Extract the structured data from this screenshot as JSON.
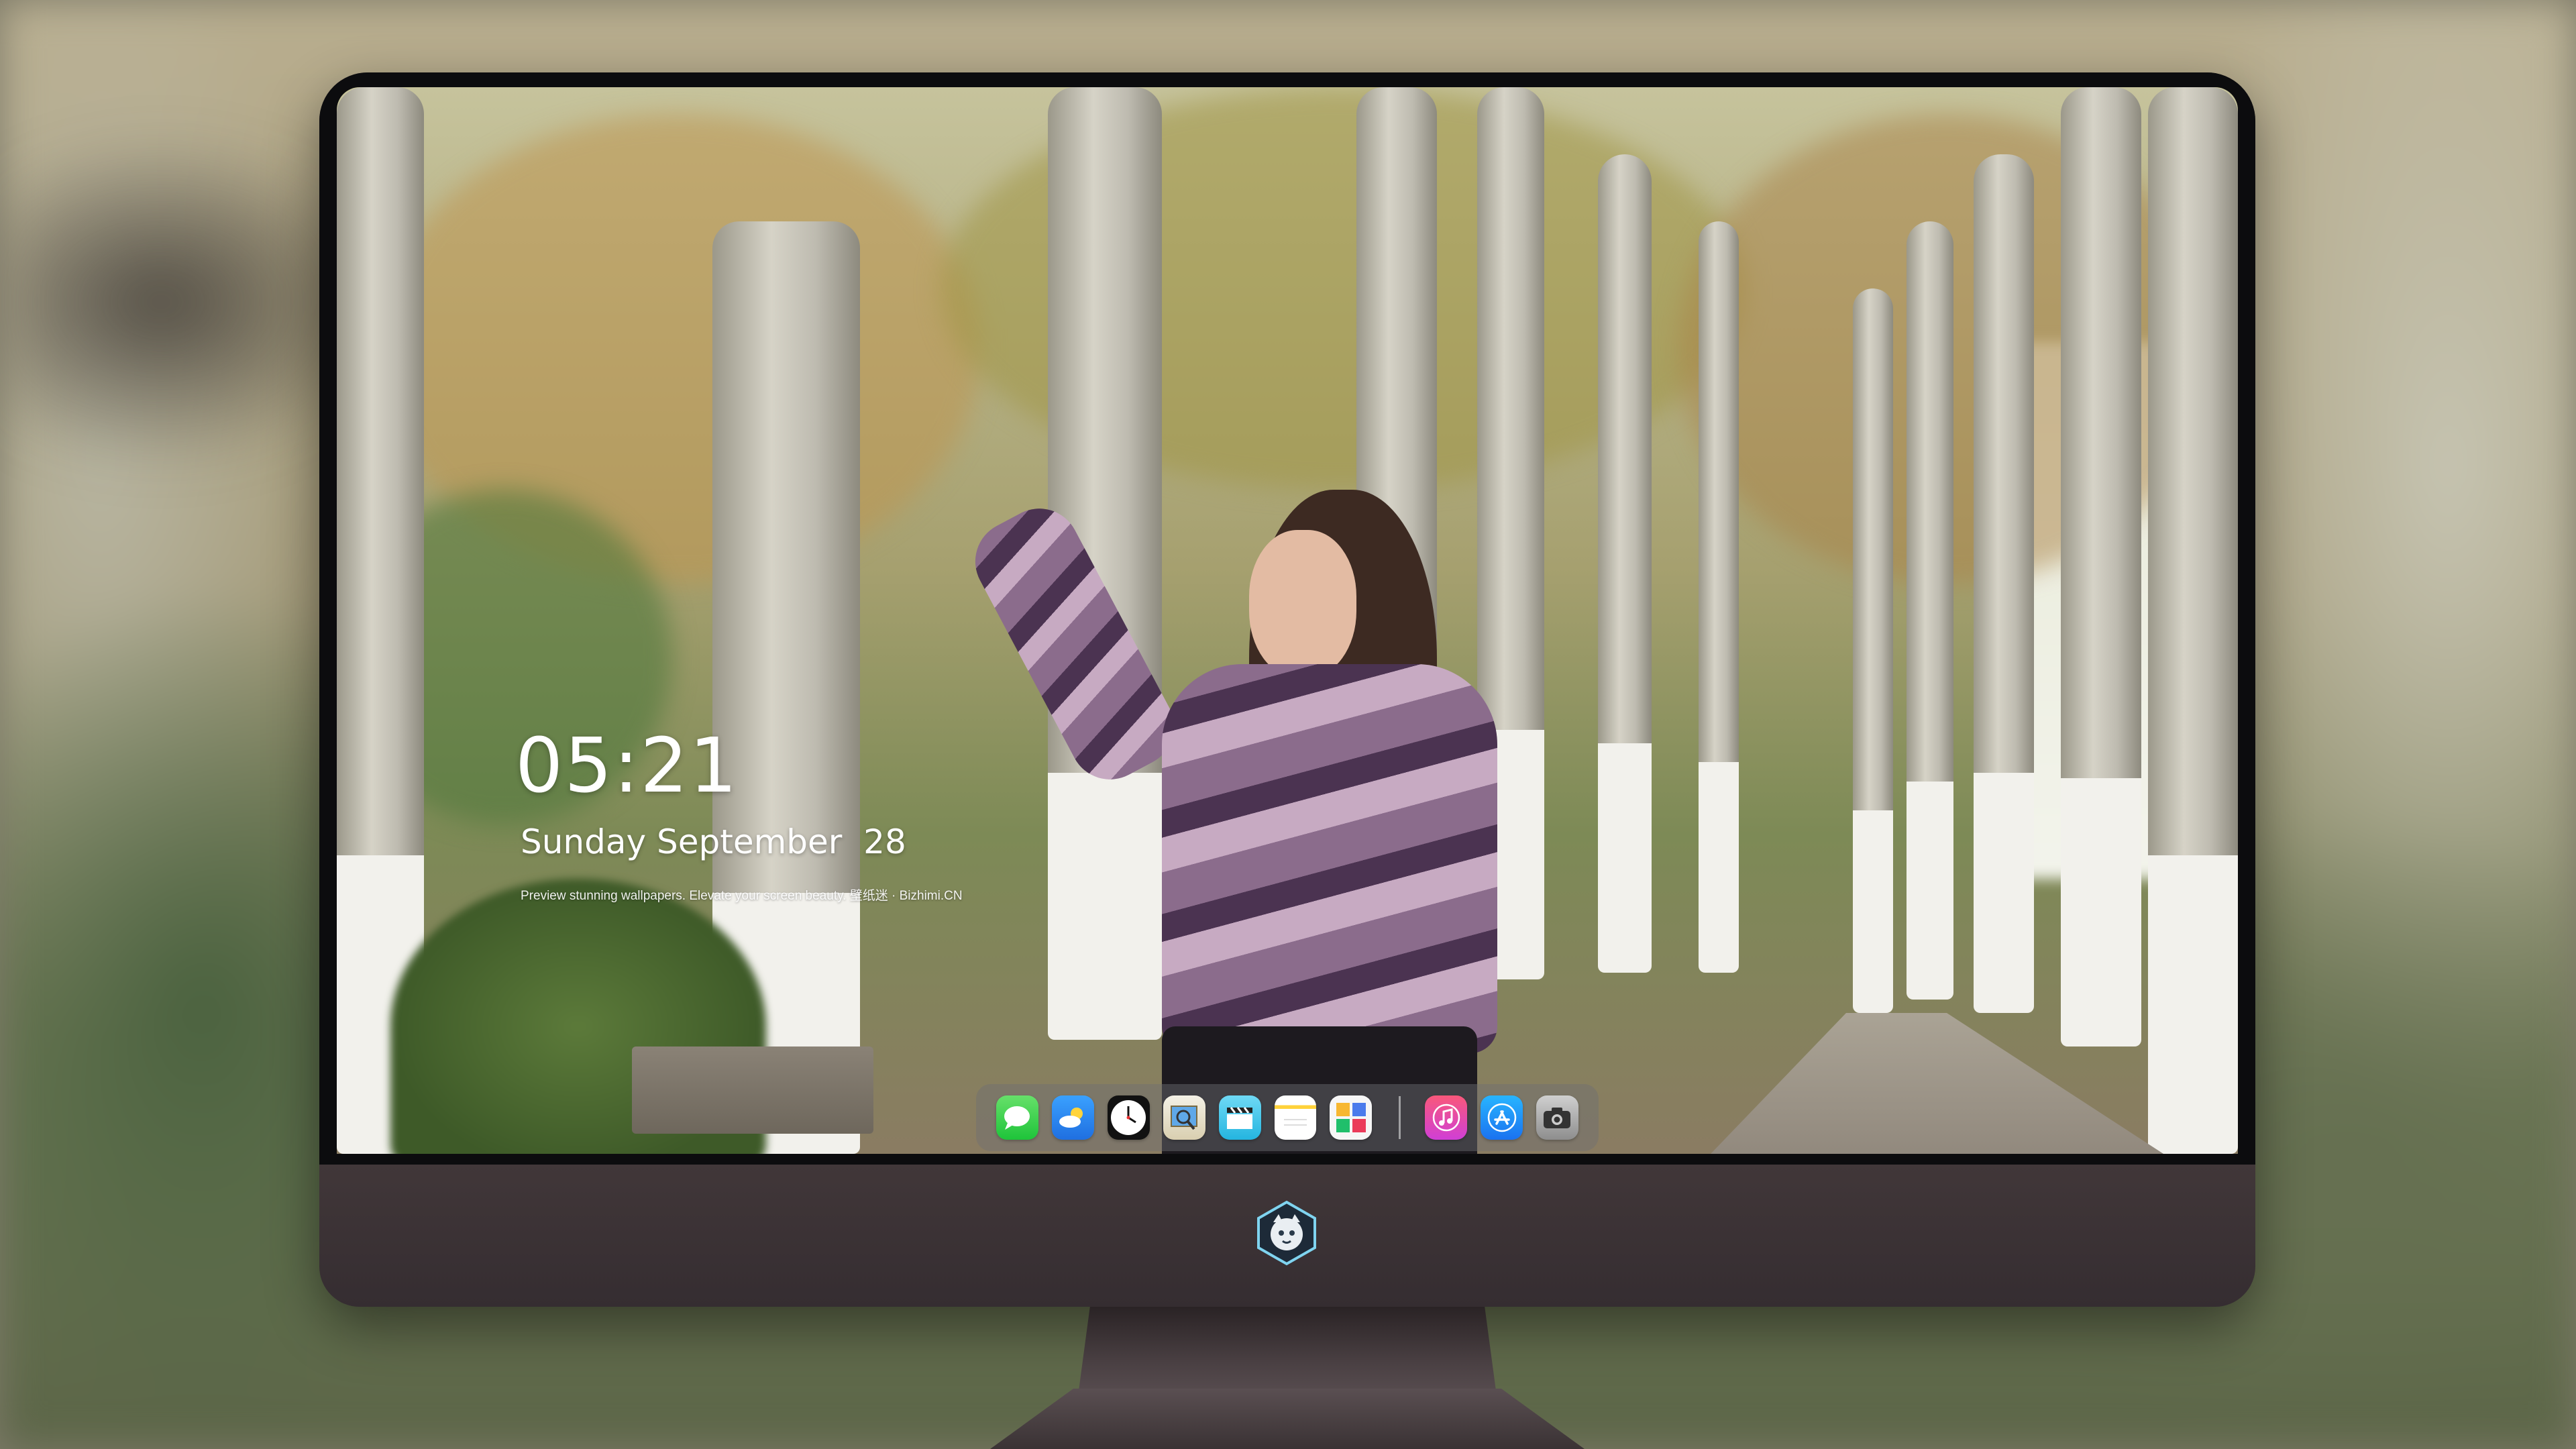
{
  "lock_screen": {
    "time": "05:21",
    "date": "Sunday September  28",
    "tagline": "Preview stunning wallpapers. Elevate your screen beauty. 壁纸迷 · Bizhimi.CN"
  },
  "dock": {
    "apps": [
      {
        "name": "Messages",
        "icon": "messages-icon"
      },
      {
        "name": "Weather",
        "icon": "weather-icon"
      },
      {
        "name": "Clock",
        "icon": "clock-icon"
      },
      {
        "name": "Preview",
        "icon": "preview-icon"
      },
      {
        "name": "Claquette",
        "icon": "clapperboard-icon"
      },
      {
        "name": "Notes",
        "icon": "notes-icon"
      },
      {
        "name": "Photos",
        "icon": "photos-icon"
      },
      {
        "name": "Music",
        "icon": "music-icon"
      },
      {
        "name": "App Store",
        "icon": "app-store-icon"
      },
      {
        "name": "Screenshot",
        "icon": "camera-icon"
      }
    ]
  },
  "colors": {
    "monitor_chin": "#3b3337",
    "bezel": "#0c0c0e",
    "dock_background": "rgba(110,110,115,0.45)"
  }
}
